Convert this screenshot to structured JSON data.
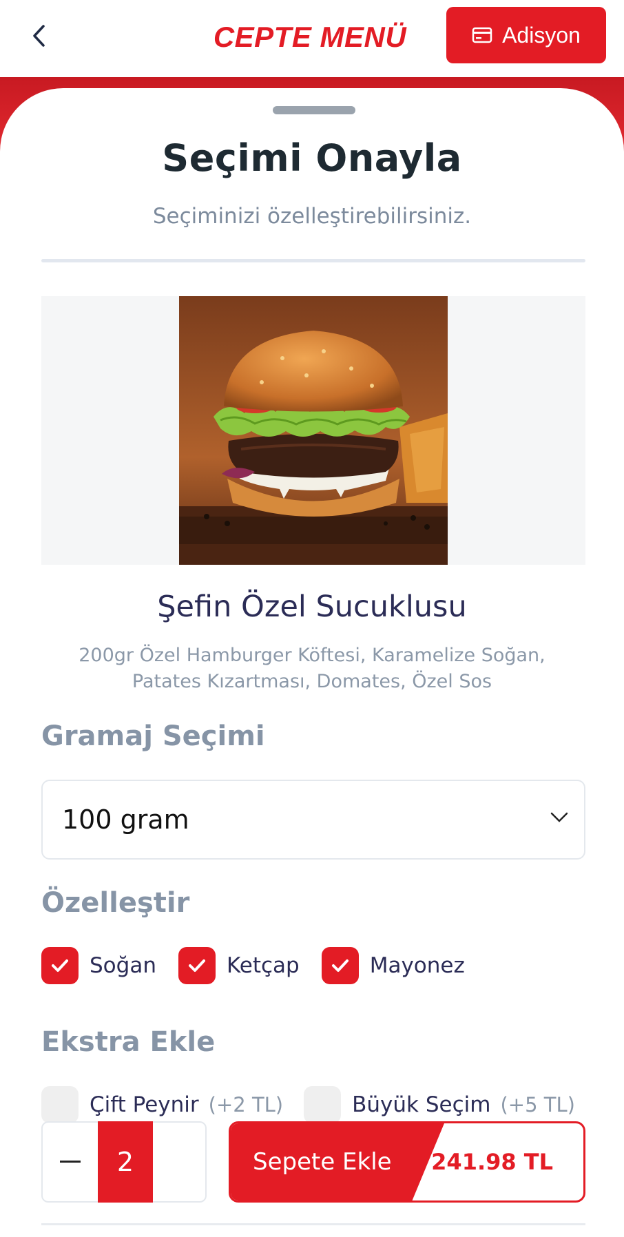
{
  "header": {
    "brand": "CEPTE MENÜ",
    "adisyon_label": "Adisyon"
  },
  "sheet": {
    "title": "Seçimi Onayla",
    "subtitle": "Seçiminizi özelleştirebilirsiniz."
  },
  "product": {
    "name": "Şefin Özel Sucuklusu",
    "description_line1": "200gr Özel Hamburger Köftesi, Karamelize Soğan,",
    "description_line2": "Patates Kızartması, Domates, Özel Sos"
  },
  "gramaj": {
    "label": "Gramaj Seçimi",
    "selected": "100 gram"
  },
  "customize": {
    "label": "Özelleştir",
    "options": [
      {
        "label": "Soğan",
        "checked": true
      },
      {
        "label": "Ketçap",
        "checked": true
      },
      {
        "label": "Mayonez",
        "checked": true
      }
    ]
  },
  "extras": {
    "label": "Ekstra Ekle",
    "options": [
      {
        "label": "Çift Peynir",
        "price": "(+2 TL)",
        "checked": false
      },
      {
        "label": "Büyük Seçim",
        "price": "(+5 TL)",
        "checked": false
      }
    ]
  },
  "order": {
    "quantity": "2",
    "cart_label": "Sepete Ekle",
    "total": "241.98 TL"
  },
  "colors": {
    "accent": "#e31c25",
    "title": "#1e2a32",
    "product_name": "#2b2c56",
    "muted": "#8694a6"
  }
}
